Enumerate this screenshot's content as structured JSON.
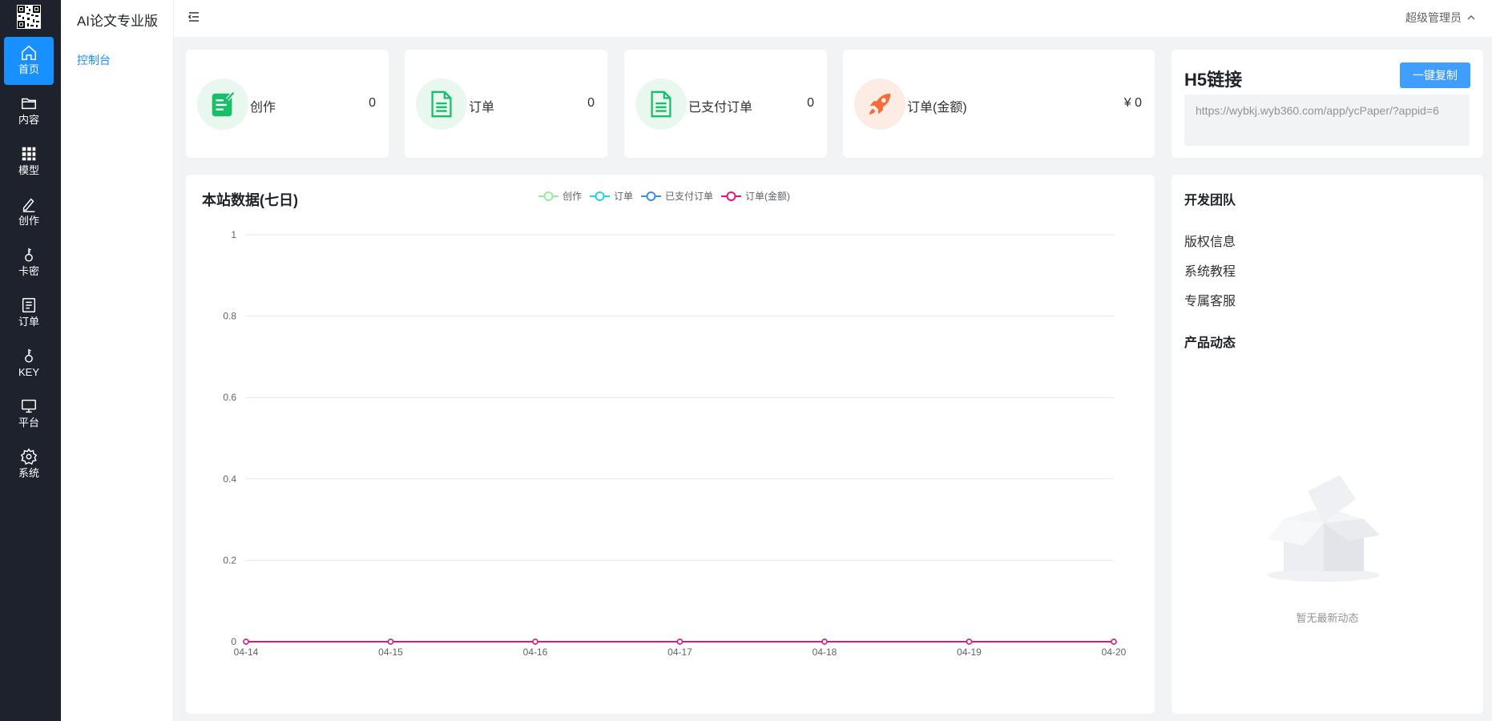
{
  "rail": {
    "items": [
      {
        "label": "首页",
        "icon": "home-icon",
        "active": true
      },
      {
        "label": "内容",
        "icon": "folder-icon"
      },
      {
        "label": "模型",
        "icon": "grid-icon"
      },
      {
        "label": "创作",
        "icon": "pen-icon"
      },
      {
        "label": "卡密",
        "icon": "key-icon"
      },
      {
        "label": "订单",
        "icon": "list-icon"
      },
      {
        "label": "KEY",
        "icon": "key-icon"
      },
      {
        "label": "平台",
        "icon": "monitor-icon"
      },
      {
        "label": "系统",
        "icon": "gear-icon"
      }
    ]
  },
  "subnav": {
    "brand": "AI论文专业版",
    "items": [
      {
        "label": "控制台",
        "active": true
      }
    ]
  },
  "topbar": {
    "user": "超级管理员"
  },
  "stats": [
    {
      "label": "创作",
      "value": "0",
      "icon": "edit-doc-icon",
      "color": "#19be6b",
      "bg": "#e8f8ef"
    },
    {
      "label": "订单",
      "value": "0",
      "icon": "doc-icon",
      "color": "#19be6b",
      "bg": "#e8f8ef"
    },
    {
      "label": "已支付订单",
      "value": "0",
      "icon": "doc-icon",
      "color": "#19be6b",
      "bg": "#e8f8ef"
    },
    {
      "label": "订单(金额)",
      "value": "¥ 0",
      "icon": "rocket-icon",
      "color": "#f56c3b",
      "bg": "#fdece4"
    }
  ],
  "h5": {
    "title": "H5链接",
    "copy_label": "一键复制",
    "url": "https://wybkj.wyb360.com/app/ycPaper/?appid=6"
  },
  "chart": {
    "title": "本站数据(七日)"
  },
  "chart_data": {
    "type": "line",
    "title": "本站数据(七日)",
    "categories": [
      "04-14",
      "04-15",
      "04-16",
      "04-17",
      "04-18",
      "04-19",
      "04-20"
    ],
    "series": [
      {
        "name": "创作",
        "color": "#91ee9b",
        "values": [
          0,
          0,
          0,
          0,
          0,
          0,
          0
        ]
      },
      {
        "name": "订单",
        "color": "#20d3e6",
        "values": [
          0,
          0,
          0,
          0,
          0,
          0,
          0
        ]
      },
      {
        "name": "已支付订单",
        "color": "#3a8ee6",
        "values": [
          0,
          0,
          0,
          0,
          0,
          0,
          0
        ]
      },
      {
        "name": "订单(金额)",
        "color": "#e6127e",
        "values": [
          0,
          0,
          0,
          0,
          0,
          0,
          0
        ]
      }
    ],
    "yticks": [
      "0",
      "0.2",
      "0.4",
      "0.6",
      "0.8",
      "1"
    ],
    "ylim": [
      0,
      1
    ],
    "grid": true,
    "legend": "top"
  },
  "team": {
    "title": "开发团队",
    "links": [
      "版权信息",
      "系统教程",
      "专属客服"
    ],
    "news_title": "产品动态",
    "empty_text": "暂无最新动态"
  }
}
